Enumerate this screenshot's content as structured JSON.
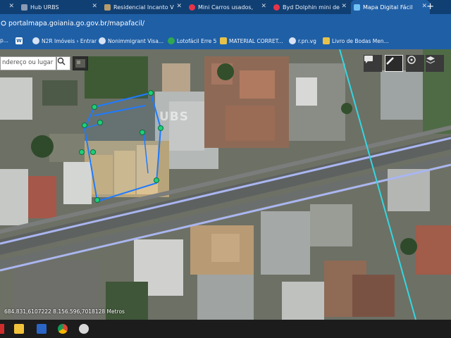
{
  "browser": {
    "tabs": [
      {
        "title": "Hub URBS",
        "active": false
      },
      {
        "title": "Residencial Incanto V",
        "active": false
      },
      {
        "title": "Mini Carros usados,",
        "active": false
      },
      {
        "title": "Byd Dolphin mini de",
        "active": false
      },
      {
        "title": "Mapa Digital Fácil",
        "active": true
      }
    ],
    "new_tab_label": "+",
    "url": "portalmapa.goiania.go.gov.br/mapafacil/"
  },
  "bookmarks": [
    {
      "label": "p..."
    },
    {
      "label": ""
    },
    {
      "label": "N2R Imóveis › Entrar"
    },
    {
      "label": "Nonimmigrant Visa..."
    },
    {
      "label": "Lotofácil Erre 5"
    },
    {
      "label": "MATERIAL CORRET..."
    },
    {
      "label": "r.pn.vg"
    },
    {
      "label": "Livro de Bodas Men..."
    }
  ],
  "map": {
    "search_placeholder": "ndereço ou lugar",
    "watermark": "UBS",
    "coordinates": "684.831,6107222 8.156.596,7018128 Metros",
    "tools": [
      "chat-icon",
      "pencil-icon",
      "compass-icon",
      "layers-icon"
    ]
  },
  "colors": {
    "tabbar": "#103f73",
    "toolbar": "#1f5fa6",
    "polygon": "#1e7bff",
    "vertex": "#1fcf7a",
    "road_line": "#aab6f0",
    "cyan_line": "#33d7e0"
  },
  "taskbar": {
    "icons": [
      "windows-start-icon",
      "file-explorer-icon",
      "word-icon",
      "chrome-icon",
      "app-icon"
    ]
  }
}
